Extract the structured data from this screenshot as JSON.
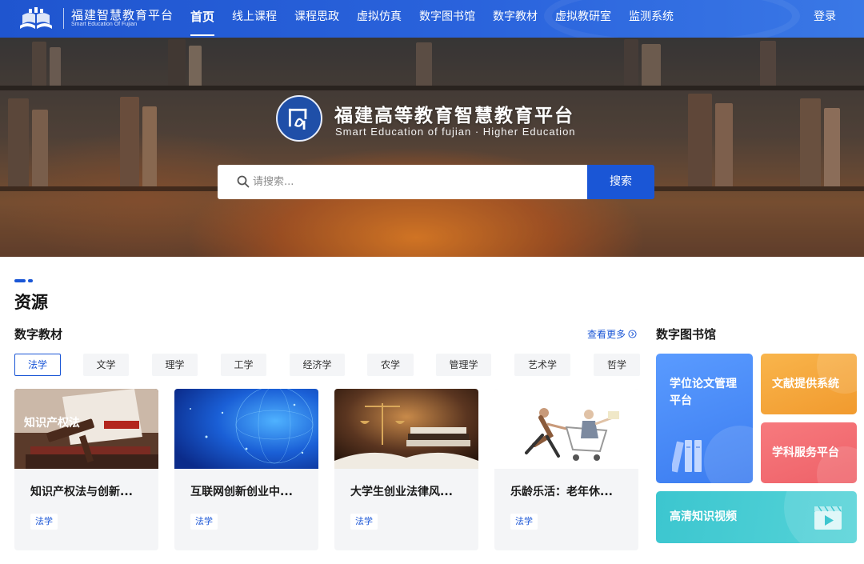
{
  "nav": {
    "logo_cn": "福建智慧教育平台",
    "logo_en": "Smart Education Of Fujian",
    "links": [
      "首页",
      "线上课程",
      "课程思政",
      "虚拟仿真",
      "数字图书馆",
      "数字教材",
      "虚拟教研室",
      "监测系统"
    ],
    "active_index": 0,
    "login": "登录"
  },
  "hero": {
    "title": "福建高等教育智慧教育平台",
    "subtitle": "Smart Education of fujian · Higher Education",
    "search_placeholder": "请搜索...",
    "search_button": "搜索"
  },
  "resources": {
    "section_title": "资源",
    "textbooks": {
      "title": "数字教材",
      "more": "查看更多",
      "tabs": [
        "法学",
        "文学",
        "理学",
        "工学",
        "经济学",
        "农学",
        "管理学",
        "艺术学",
        "哲学"
      ],
      "active_tab": 0,
      "cards": [
        {
          "title": "知识产权法与创新...",
          "tag": "法学",
          "image": "gavel-books-image",
          "image_text": "知识产权法"
        },
        {
          "title": "互联网创新创业中...",
          "tag": "法学",
          "image": "digital-globe-image"
        },
        {
          "title": "大学生创业法律风...",
          "tag": "法学",
          "image": "scales-books-image"
        },
        {
          "title": "乐龄乐活：老年休...",
          "tag": "法学",
          "image": "elderly-cart-image"
        }
      ]
    },
    "library": {
      "title": "数字图书馆",
      "tiles": [
        {
          "label": "学位论文管理平台",
          "color": "#4a8cf7"
        },
        {
          "label": "文献提供系统",
          "color": "#f3a43c"
        },
        {
          "label": "学科服务平台",
          "color": "#f06d72"
        },
        {
          "label": "高清知识视频",
          "color": "#3fc7cf"
        }
      ]
    }
  },
  "colors": {
    "primary": "#1a56d6",
    "nav": "#2a63dc"
  }
}
